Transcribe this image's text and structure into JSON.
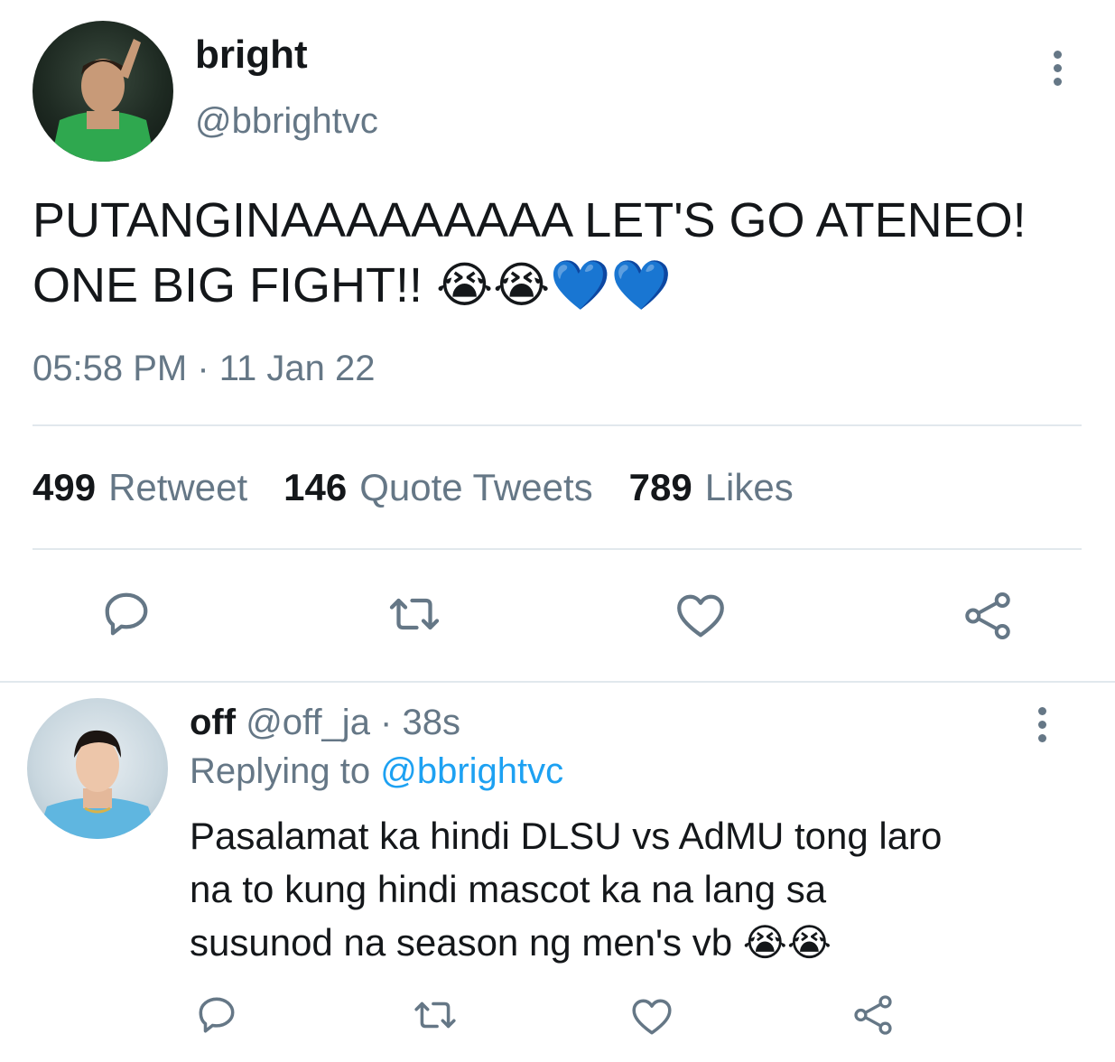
{
  "tweet": {
    "author": {
      "name": "bright",
      "handle": "@bbrightvc"
    },
    "text": "PUTANGINAAAAAAAAA LET'S GO ATENEO!\nONE BIG FIGHT!! 😭😭💙💙",
    "timestamp": "05:58 PM · 11 Jan 22",
    "stats": {
      "retweets_count": "499",
      "retweets_label": "Retweet",
      "quotes_count": "146",
      "quotes_label": "Quote Tweets",
      "likes_count": "789",
      "likes_label": "Likes"
    },
    "actions": [
      "reply-icon",
      "retweet-icon",
      "heart-icon",
      "share-icon"
    ]
  },
  "reply": {
    "author": {
      "name": "off",
      "meta": "@off_ja · 38s"
    },
    "replying_to_label": "Replying to",
    "replying_to_handle": "@bbrightvc",
    "text": "Pasalamat ka hindi DLSU vs AdMU tong laro\nna to kung hindi mascot ka na lang sa\nsusunod na season ng men's vb 😭😭",
    "actions": [
      "reply-icon",
      "retweet-icon",
      "heart-icon",
      "share-icon"
    ]
  },
  "colors": {
    "primary_text": "#14171a",
    "secondary_text": "#657786",
    "link": "#1da1f2",
    "divider": "#e1e8ed",
    "heart_emoji": "#3aa0e8"
  }
}
